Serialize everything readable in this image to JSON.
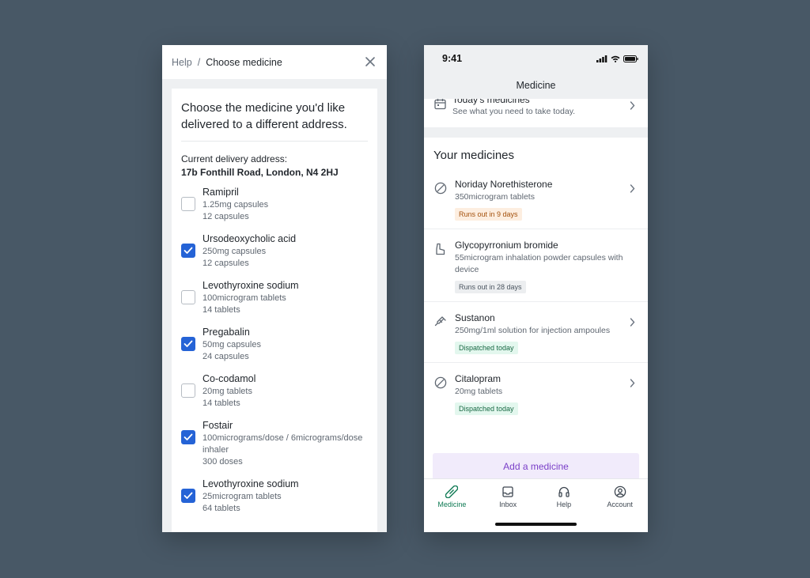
{
  "left_panel": {
    "breadcrumb": {
      "parent": "Help",
      "separator": "/",
      "current": "Choose medicine"
    },
    "title": "Choose the medicine you'd like delivered to a different address.",
    "address_label": "Current delivery address:",
    "address_value": "17b Fonthill Road, London, N4 2HJ",
    "medicines": [
      {
        "name": "Ramipril",
        "strength": "1.25mg capsules",
        "qty": "12 capsules",
        "checked": false
      },
      {
        "name": "Ursodeoxycholic acid",
        "strength": "250mg capsules",
        "qty": "12 capsules",
        "checked": true
      },
      {
        "name": "Levothyroxine sodium",
        "strength": "100microgram tablets",
        "qty": "14 tablets",
        "checked": false
      },
      {
        "name": "Pregabalin",
        "strength": "50mg capsules",
        "qty": "24 capsules",
        "checked": true
      },
      {
        "name": "Co-codamol",
        "strength": "20mg tablets",
        "qty": "14 tablets",
        "checked": false
      },
      {
        "name": "Fostair",
        "strength": "100micrograms/dose / 6micrograms/dose inhaler",
        "qty": "300 doses",
        "checked": true
      },
      {
        "name": "Levothyroxine sodium",
        "strength": "25microgram tablets",
        "qty": "64 tablets",
        "checked": true
      }
    ]
  },
  "phone": {
    "status_time": "9:41",
    "nav_title": "Medicine",
    "today": {
      "title": "Today's medicines",
      "subtitle": "See what you need to take today."
    },
    "section_title": "Your medicines",
    "items": [
      {
        "name": "Noriday Norethisterone",
        "desc": "350microgram tablets",
        "badge": "Runs out in 9 days",
        "badge_kind": "warn",
        "icon": "pill-icon"
      },
      {
        "name": "Glycopyrronium bromide",
        "desc": "55microgram inhalation powder capsules with device",
        "badge": "Runs out in 28 days",
        "badge_kind": "neutral",
        "icon": "inhaler-icon"
      },
      {
        "name": "Sustanon",
        "desc": "250mg/1ml solution for injection ampoules",
        "badge": "Dispatched today",
        "badge_kind": "ok",
        "icon": "syringe-icon"
      },
      {
        "name": "Citalopram",
        "desc": "20mg tablets",
        "badge": "Dispatched today",
        "badge_kind": "ok",
        "icon": "pill-icon"
      }
    ],
    "add_button": "Add a medicine",
    "tabs": [
      {
        "label": "Medicine",
        "icon": "capsule-icon",
        "active": true
      },
      {
        "label": "Inbox",
        "icon": "inbox-icon",
        "active": false
      },
      {
        "label": "Help",
        "icon": "headset-icon",
        "active": false
      },
      {
        "label": "Account",
        "icon": "account-icon",
        "active": false
      }
    ]
  },
  "colors": {
    "background": "#485866",
    "checkbox_checked": "#2563d6",
    "accent_green": "#0f7a54",
    "add_button_text": "#7a3fc8"
  }
}
